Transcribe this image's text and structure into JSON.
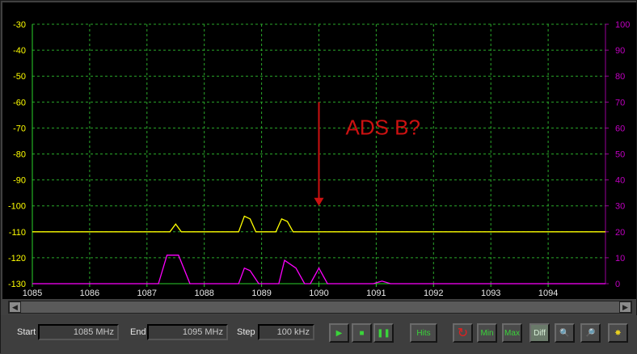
{
  "chart_data": {
    "type": "line",
    "x": {
      "min": 1085,
      "max": 1095,
      "ticks": [
        1085,
        1086,
        1087,
        1088,
        1089,
        1090,
        1091,
        1092,
        1093,
        1094
      ],
      "tick_labels": [
        "1085",
        "1086",
        "1087",
        "1088",
        "1089",
        "1090",
        "1091",
        "1092",
        "1093",
        "1094"
      ]
    },
    "y_left": {
      "min": -130,
      "max": -30,
      "ticks": [
        -30,
        -40,
        -50,
        -60,
        -70,
        -80,
        -90,
        -100,
        -110,
        -120,
        -130
      ],
      "tick_labels": [
        "-30",
        "-40",
        "-50",
        "-60",
        "-70",
        "-80",
        "-90",
        "-100",
        "-110",
        "-120",
        "-130"
      ],
      "color": "#ffff00"
    },
    "y_right": {
      "min": 0,
      "max": 100,
      "ticks": [
        100,
        90,
        80,
        70,
        60,
        50,
        40,
        30,
        20,
        10,
        0
      ],
      "tick_labels": [
        "100",
        "90",
        "80",
        "70",
        "60",
        "50",
        "40",
        "30",
        "20",
        "10",
        "0"
      ],
      "color": "#c000c0"
    },
    "grid": true,
    "grid_color": "#2aa82a",
    "series": [
      {
        "axis": "left",
        "color": "#ffff00",
        "points": [
          [
            1085,
            -110
          ],
          [
            1087.4,
            -110
          ],
          [
            1087.5,
            -107
          ],
          [
            1087.6,
            -110
          ],
          [
            1088.6,
            -110
          ],
          [
            1088.7,
            -104
          ],
          [
            1088.8,
            -105
          ],
          [
            1088.9,
            -110
          ],
          [
            1089.25,
            -110
          ],
          [
            1089.35,
            -105
          ],
          [
            1089.45,
            -106
          ],
          [
            1089.55,
            -110
          ],
          [
            1095,
            -110
          ]
        ]
      },
      {
        "axis": "right",
        "color": "#ff00ff",
        "points": [
          [
            1085,
            0
          ],
          [
            1087.2,
            0
          ],
          [
            1087.35,
            11
          ],
          [
            1087.55,
            11
          ],
          [
            1087.75,
            0
          ],
          [
            1088.6,
            0
          ],
          [
            1088.7,
            6
          ],
          [
            1088.8,
            5
          ],
          [
            1088.95,
            0
          ],
          [
            1089.3,
            0
          ],
          [
            1089.4,
            9
          ],
          [
            1089.6,
            6
          ],
          [
            1089.75,
            0
          ],
          [
            1089.85,
            0
          ],
          [
            1090.0,
            6
          ],
          [
            1090.15,
            0
          ],
          [
            1090.95,
            0
          ],
          [
            1091.1,
            1
          ],
          [
            1091.25,
            0
          ],
          [
            1095,
            0
          ]
        ]
      }
    ],
    "annotation": {
      "text": "ADS B?",
      "x": 1090,
      "y_top": -60,
      "y_bottom": -100,
      "color": "#cc1111"
    }
  },
  "controls": {
    "start_label": "Start",
    "start_value": "1085 MHz",
    "end_label": "End",
    "end_value": "1095 MHz",
    "step_label": "Step",
    "step_value": "100 kHz",
    "play_icon": "play-icon",
    "stop_icon": "stop-icon",
    "pause_icon": "pause-icon",
    "hits_label": "Hits",
    "refresh_icon": "refresh-icon",
    "min_label": "Min",
    "max_label": "Max",
    "diff_label": "Diff",
    "zoom_out_icon": "zoom-out-icon",
    "zoom_in_icon": "zoom-in-icon",
    "settings_icon": "settings-icon"
  }
}
